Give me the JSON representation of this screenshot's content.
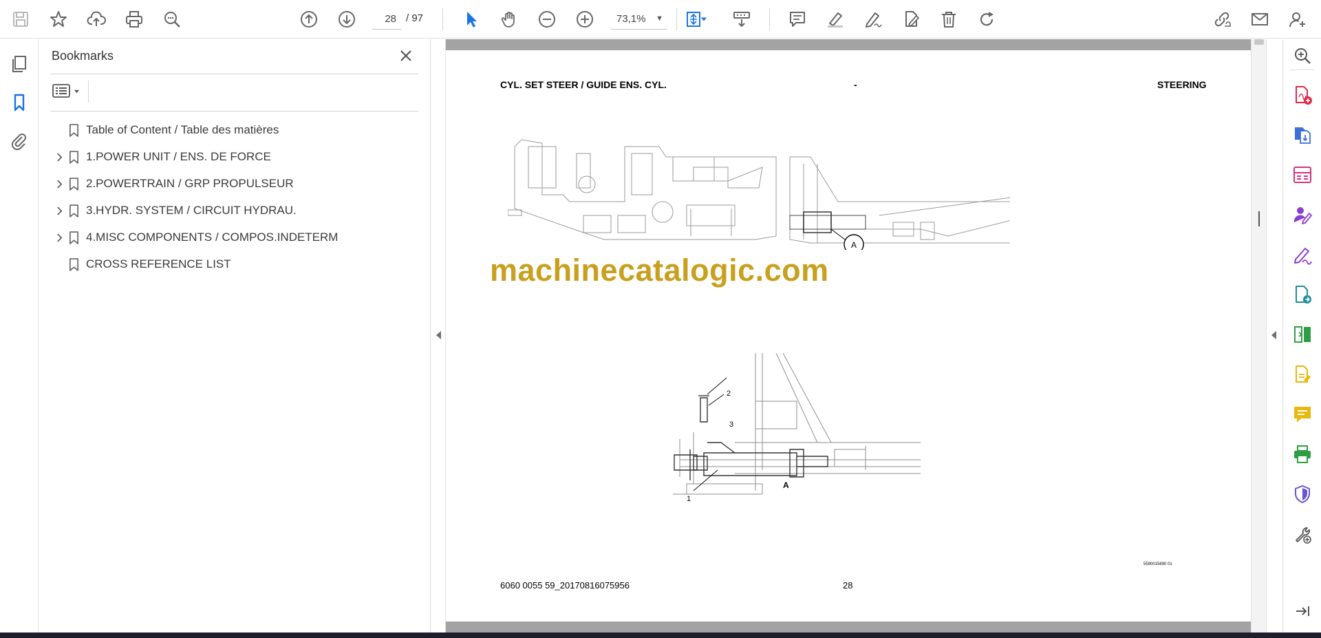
{
  "toolbar": {
    "page_current": "28",
    "page_total": "/ 97",
    "zoom": "73,1%"
  },
  "bookmarks": {
    "title": "Bookmarks",
    "items": [
      {
        "label": "Table of Content / Table des matières",
        "expandable": false
      },
      {
        "label": "1.POWER UNIT / ENS. DE FORCE",
        "expandable": true
      },
      {
        "label": "2.POWERTRAIN / GRP PROPULSEUR",
        "expandable": true
      },
      {
        "label": "3.HYDR. SYSTEM / CIRCUIT HYDRAU.",
        "expandable": true
      },
      {
        "label": "4.MISC COMPONENTS / COMPOS.INDETERM",
        "expandable": true
      },
      {
        "label": "CROSS REFERENCE LIST",
        "expandable": false
      }
    ]
  },
  "page": {
    "header_left": "CYL. SET STEER / GUIDE ENS. CYL.",
    "header_mid": "-",
    "header_right": "STEERING",
    "watermark": "machinecatalogic.com",
    "callout_a": "A",
    "detail_label_a": "A",
    "part_1": "1",
    "part_2": "2",
    "part_3": "3",
    "drawing_id": "5590015890 01",
    "footer_left": "6060 0055 59_20170816075956",
    "footer_page": "28"
  },
  "colors": {
    "accent_blue": "#1a73e8",
    "watermark": "#c9a01e",
    "tool_red": "#e0284b",
    "tool_blue": "#3d6fd6",
    "tool_pink": "#d4317a",
    "tool_purple": "#8a3ed4",
    "tool_teal": "#1b8f9a",
    "tool_green": "#2e9e44",
    "tool_yellow": "#e8b80b",
    "tool_indigo": "#6a55d8"
  }
}
